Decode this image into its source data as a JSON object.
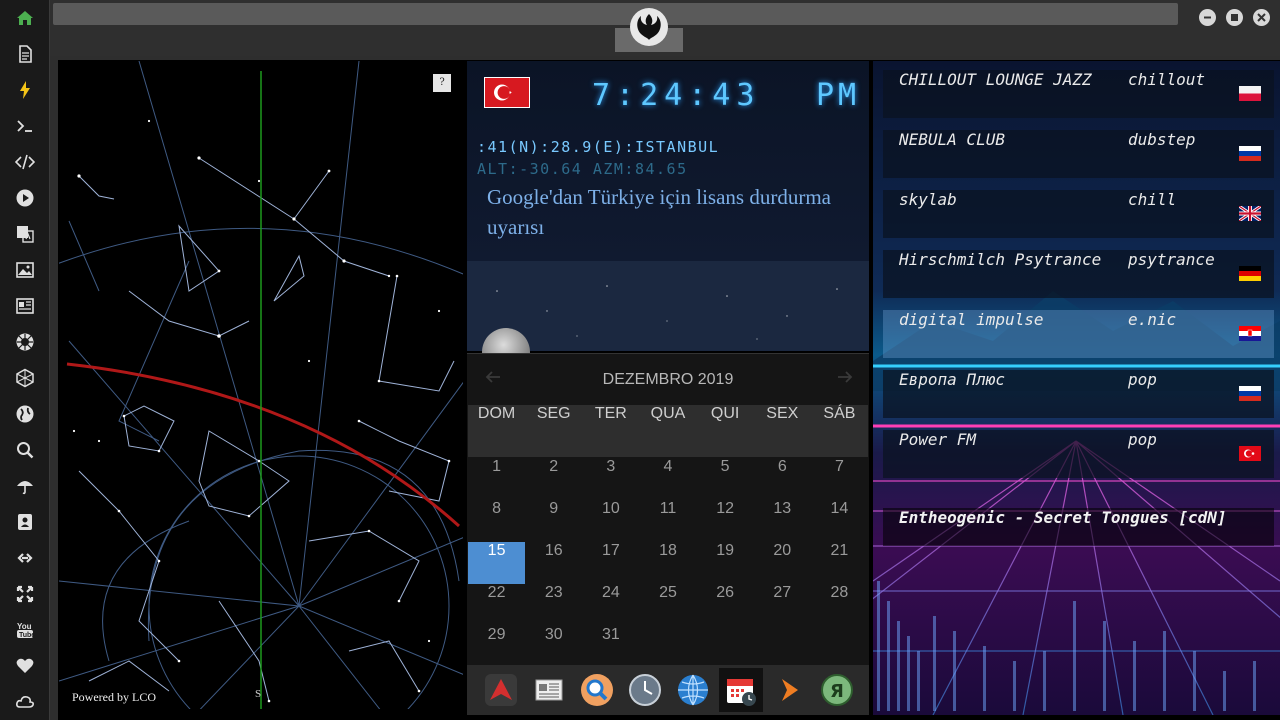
{
  "sidebar": {
    "items": [
      {
        "icon": "home-icon"
      },
      {
        "icon": "document-icon"
      },
      {
        "icon": "lightning-icon"
      },
      {
        "icon": "terminal-icon"
      },
      {
        "icon": "code-icon"
      },
      {
        "icon": "play-icon"
      },
      {
        "icon": "translate-icon"
      },
      {
        "icon": "image-icon"
      },
      {
        "icon": "news-icon"
      },
      {
        "icon": "rebel-alliance-icon"
      },
      {
        "icon": "hexagon-icon"
      },
      {
        "icon": "globe-icon"
      },
      {
        "icon": "search-icon"
      },
      {
        "icon": "umbrella-icon"
      },
      {
        "icon": "contact-card-icon"
      },
      {
        "icon": "chain-link-icon"
      },
      {
        "icon": "expand-icon"
      },
      {
        "icon": "youtube-icon"
      },
      {
        "icon": "heart-icon"
      },
      {
        "icon": "cloud-icon"
      }
    ],
    "accent": "#4caf50"
  },
  "window": {
    "logo": "rebel-alliance-logo",
    "controls": [
      "minimize-icon",
      "maximize-icon",
      "close-icon"
    ]
  },
  "starmap": {
    "help_label": "?",
    "powered_by": "Powered by LCO",
    "direction_label": "S"
  },
  "clock": {
    "country_flag": "turkey-flag",
    "time": "7:24:43",
    "ampm": "PM",
    "location": ":41(N):28.9(E):ISTANBUL",
    "alt_azm": "ALT:-30.64 AZM:84.65",
    "headline": "Google'dan Türkiye için lisans durdurma uyarısı"
  },
  "calendar": {
    "title": "DEZEMBRO 2019",
    "weekdays": [
      "DOM",
      "SEG",
      "TER",
      "QUA",
      "QUI",
      "SEX",
      "SÁB"
    ],
    "weeks": [
      [
        "1",
        "2",
        "3",
        "4",
        "5",
        "6",
        "7"
      ],
      [
        "8",
        "9",
        "10",
        "11",
        "12",
        "13",
        "14"
      ],
      [
        "15",
        "16",
        "17",
        "18",
        "19",
        "20",
        "21"
      ],
      [
        "22",
        "23",
        "24",
        "25",
        "26",
        "27",
        "28"
      ],
      [
        "29",
        "30",
        "31",
        "",
        "",
        "",
        ""
      ]
    ],
    "today": "15",
    "today_color": "#4d8ed2"
  },
  "dock": {
    "apps": [
      {
        "icon": "red-triangle-app-icon"
      },
      {
        "icon": "newspaper-app-icon"
      },
      {
        "icon": "search-app-icon"
      },
      {
        "icon": "clock-app-icon"
      },
      {
        "icon": "globe-app-icon"
      },
      {
        "icon": "calendar-app-icon",
        "active": true
      },
      {
        "icon": "play-arrow-app-icon"
      },
      {
        "icon": "yandex-app-icon"
      }
    ]
  },
  "radio": {
    "stations": [
      {
        "name": "CHILLOUT LOUNGE JAZZ",
        "genre": "chillout",
        "flag": "poland-flag"
      },
      {
        "name": "NEBULA CLUB",
        "genre": "dubstep",
        "flag": "russia-flag"
      },
      {
        "name": "skylab",
        "genre": "chill",
        "flag": "uk-flag"
      },
      {
        "name": "Hirschmilch Psytrance",
        "genre": "psytrance",
        "flag": "germany-flag"
      },
      {
        "name": "digital impulse",
        "genre": "e.nic",
        "flag": "croatia-flag",
        "selected": true
      },
      {
        "name": "Европа Плюс",
        "genre": "pop",
        "flag": "russia-flag"
      },
      {
        "name": "Power FM",
        "genre": "pop",
        "flag": "turkey-flag"
      }
    ],
    "now_playing": "Entheogenic - Secret Tongues [cdN]"
  }
}
